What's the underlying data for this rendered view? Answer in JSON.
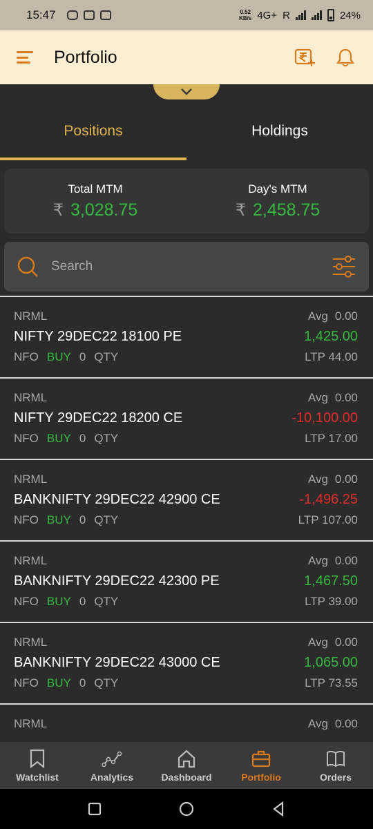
{
  "status_bar": {
    "time": "15:47",
    "speed": "0.52\nKB/s",
    "network": "4G+",
    "roaming": "R",
    "battery": "24%"
  },
  "header": {
    "title": "Portfolio",
    "menu_icon": "hamburger-icon",
    "funds_icon": "rupee-add-icon",
    "notification_icon": "bell-icon"
  },
  "tabs": [
    {
      "label": "Positions",
      "active": true
    },
    {
      "label": "Holdings",
      "active": false
    }
  ],
  "mtm": {
    "total_label": "Total MTM",
    "total_currency": "₹",
    "total_value": "3,028.75",
    "day_label": "Day's MTM",
    "day_currency": "₹",
    "day_value": "2,458.75"
  },
  "search": {
    "placeholder": "Search",
    "value": ""
  },
  "positions": [
    {
      "product": "NRML",
      "avg_label": "Avg",
      "avg": "0.00",
      "symbol": "NIFTY 29DEC22 18100 PE",
      "pnl": "1,425.00",
      "pnl_sign": "pos",
      "exchange": "NFO",
      "side": "BUY",
      "qty": "0",
      "qty_label": "QTY",
      "ltp_label": "LTP",
      "ltp": "44.00"
    },
    {
      "product": "NRML",
      "avg_label": "Avg",
      "avg": "0.00",
      "symbol": "NIFTY 29DEC22 18200 CE",
      "pnl": "-10,100.00",
      "pnl_sign": "neg",
      "exchange": "NFO",
      "side": "BUY",
      "qty": "0",
      "qty_label": "QTY",
      "ltp_label": "LTP",
      "ltp": "17.00"
    },
    {
      "product": "NRML",
      "avg_label": "Avg",
      "avg": "0.00",
      "symbol": "BANKNIFTY 29DEC22 42900 CE",
      "pnl": "-1,496.25",
      "pnl_sign": "neg",
      "exchange": "NFO",
      "side": "BUY",
      "qty": "0",
      "qty_label": "QTY",
      "ltp_label": "LTP",
      "ltp": "107.00"
    },
    {
      "product": "NRML",
      "avg_label": "Avg",
      "avg": "0.00",
      "symbol": "BANKNIFTY 29DEC22 42300 PE",
      "pnl": "1,467.50",
      "pnl_sign": "pos",
      "exchange": "NFO",
      "side": "BUY",
      "qty": "0",
      "qty_label": "QTY",
      "ltp_label": "LTP",
      "ltp": "39.00"
    },
    {
      "product": "NRML",
      "avg_label": "Avg",
      "avg": "0.00",
      "symbol": "BANKNIFTY 29DEC22 43000 CE",
      "pnl": "1,065.00",
      "pnl_sign": "pos",
      "exchange": "NFO",
      "side": "BUY",
      "qty": "0",
      "qty_label": "QTY",
      "ltp_label": "LTP",
      "ltp": "73.55"
    },
    {
      "product": "NRML",
      "avg_label": "Avg",
      "avg": "0.00",
      "symbol": "",
      "pnl": "",
      "pnl_sign": "neg",
      "exchange": "",
      "side": "",
      "qty": "",
      "qty_label": "",
      "ltp_label": "",
      "ltp": ""
    }
  ],
  "bottom_nav": [
    {
      "label": "Watchlist",
      "icon": "bookmark-icon",
      "active": false
    },
    {
      "label": "Analytics",
      "icon": "analytics-icon",
      "active": false
    },
    {
      "label": "Dashboard",
      "icon": "home-icon",
      "active": false
    },
    {
      "label": "Portfolio",
      "icon": "briefcase-icon",
      "active": true
    },
    {
      "label": "Orders",
      "icon": "book-icon",
      "active": false
    }
  ],
  "colors": {
    "accent": "#e0b34d",
    "orange": "#d97a1b",
    "profit": "#34b93e",
    "loss": "#e22b2b",
    "header_bg": "#fbeed3",
    "background": "#2b2b2b"
  }
}
